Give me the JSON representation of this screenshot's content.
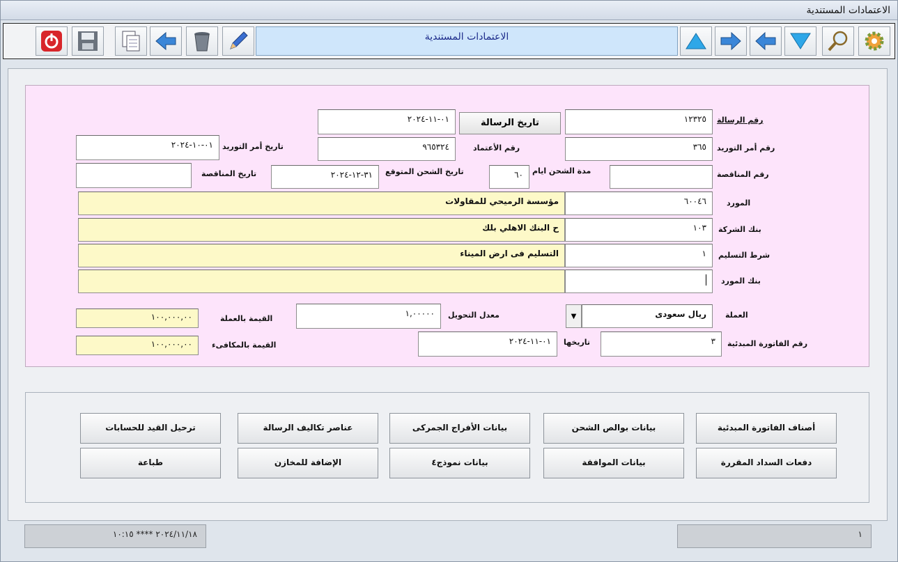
{
  "window": {
    "title": "الاعتمادات المستندية"
  },
  "toolbar": {
    "title": "الاعتمادات المستندية",
    "icons": [
      "power-icon",
      "save-icon",
      "copy-icon",
      "return-icon",
      "trash-icon",
      "pencil-icon",
      "up-triangle-icon",
      "next-arrow-icon",
      "prev-arrow-icon",
      "down-triangle-icon",
      "search-icon",
      "gear-icon"
    ]
  },
  "form": {
    "message_no": {
      "label": "رقم الرسالة",
      "value": "١٢٣٢٥"
    },
    "message_date_button": "تاريخ الرسالة",
    "message_date": "٠١-١١-٢٠٢٤",
    "po_no": {
      "label": "رقم أمر التوريد",
      "value": "٣٦٥"
    },
    "approval_no": {
      "label": "رقم الأعتماد",
      "value": "٩٦٥٣٢٤"
    },
    "po_date": {
      "label": "تاريخ أمر التوريد",
      "value": "٠١-١٠-٢٠٢٤"
    },
    "tender_no": {
      "label": "رقم المناقصة",
      "value": ""
    },
    "shipping_days": {
      "label": "مدة الشحن ايام",
      "value": "٦٠"
    },
    "expected_ship_date": {
      "label": "تاريخ الشحن المتوقع",
      "value": "٣١-١٢-٢٠٢٤"
    },
    "tender_date": {
      "label": "تاريخ المناقصة",
      "value": ""
    },
    "supplier": {
      "label": "المورد",
      "code": "٦٠٠٤٦",
      "name": "مؤسسة الرميحي للمقاولات"
    },
    "company_bank": {
      "label": "بنك الشركة",
      "code": "١٠٣",
      "name": "ح البنك الاهلي بلك"
    },
    "delivery_term": {
      "label": "شرط التسليم",
      "code": "١",
      "name": "التسليم فى ارض الميناء"
    },
    "supplier_bank": {
      "label": "بنك المورد",
      "code": "",
      "name": ""
    },
    "currency": {
      "label": "العملة",
      "value": "ريال سعودى"
    },
    "exchange_rate": {
      "label": "معدل التحويل",
      "value": "١,٠٠٠٠٠"
    },
    "value_currency": {
      "label": "القيمة بالعملة",
      "value": "١٠٠,٠٠٠,٠٠"
    },
    "proforma_no": {
      "label": "رقم الفاتورة المبدئية",
      "value": "٣"
    },
    "proforma_date": {
      "label": "تاريخها",
      "value": "٠١-١١-٢٠٢٤"
    },
    "value_equivalent": {
      "label": "القيمة بالمكافىء",
      "value": "١٠٠,٠٠٠,٠٠"
    }
  },
  "actions": {
    "row1": [
      "أصناف الفاتورة المبدئية",
      "بيانات بوالص الشحن",
      "بيانات الأفراج الجمركى",
      "عناصر تكاليف الرسالة",
      "ترحيل القيد للحسابات"
    ],
    "row2": [
      "دفعات السداد المقررة",
      "بيانات الموافقة",
      "بيانات نموذج٤",
      "الإضافة للمخازن",
      "طباعة"
    ]
  },
  "status": {
    "left": "٢٠٢٤/١١/١٨ **** ١٠:١٥",
    "right": "١"
  },
  "colors": {
    "pink_panel": "#fde4fb",
    "yellow_field": "#fdf9c8",
    "toolbar_title": "#cfe6fb"
  }
}
